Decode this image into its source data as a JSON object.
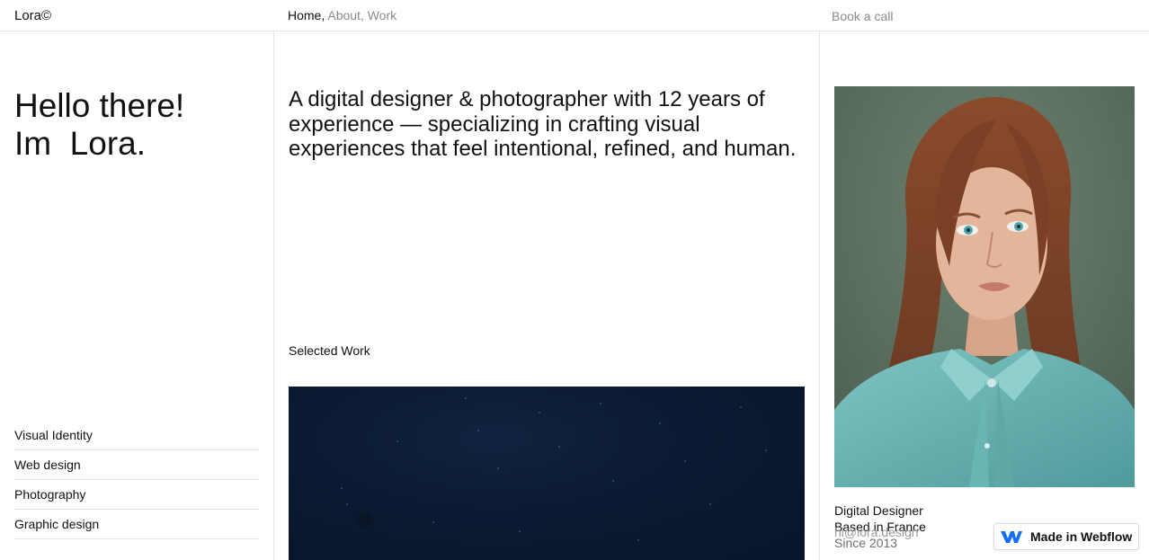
{
  "header": {
    "logo": "Lora©",
    "nav": [
      {
        "label": "Home,",
        "active": true
      },
      {
        "label": " About,",
        "active": false
      },
      {
        "label": " Work",
        "active": false
      }
    ],
    "cta": "Book a call"
  },
  "hero": {
    "line1": "Hello there!",
    "line2": "Im  Lora."
  },
  "services": [
    "Visual Identity",
    "Web design",
    "Photography",
    "Graphic design"
  ],
  "intro": "A digital designer & photographer with 12 years of experience — specializing in crafting visual experiences that feel intentional, refined, and human.",
  "work": {
    "title": "Selected Work"
  },
  "profile": {
    "role": "Digital Designer",
    "location": "Based in France",
    "email": "hi@lora.design",
    "since": "Since 2013"
  },
  "badge": {
    "label": "Made in Webflow",
    "icon": "webflow-logo-icon",
    "color": "#146ef5"
  },
  "colors": {
    "text": "#111111",
    "muted": "#8a8a8a",
    "divider": "#e6e6e6",
    "work_bg": "#0b1a32",
    "portrait_bg": "#5a6e5e"
  }
}
